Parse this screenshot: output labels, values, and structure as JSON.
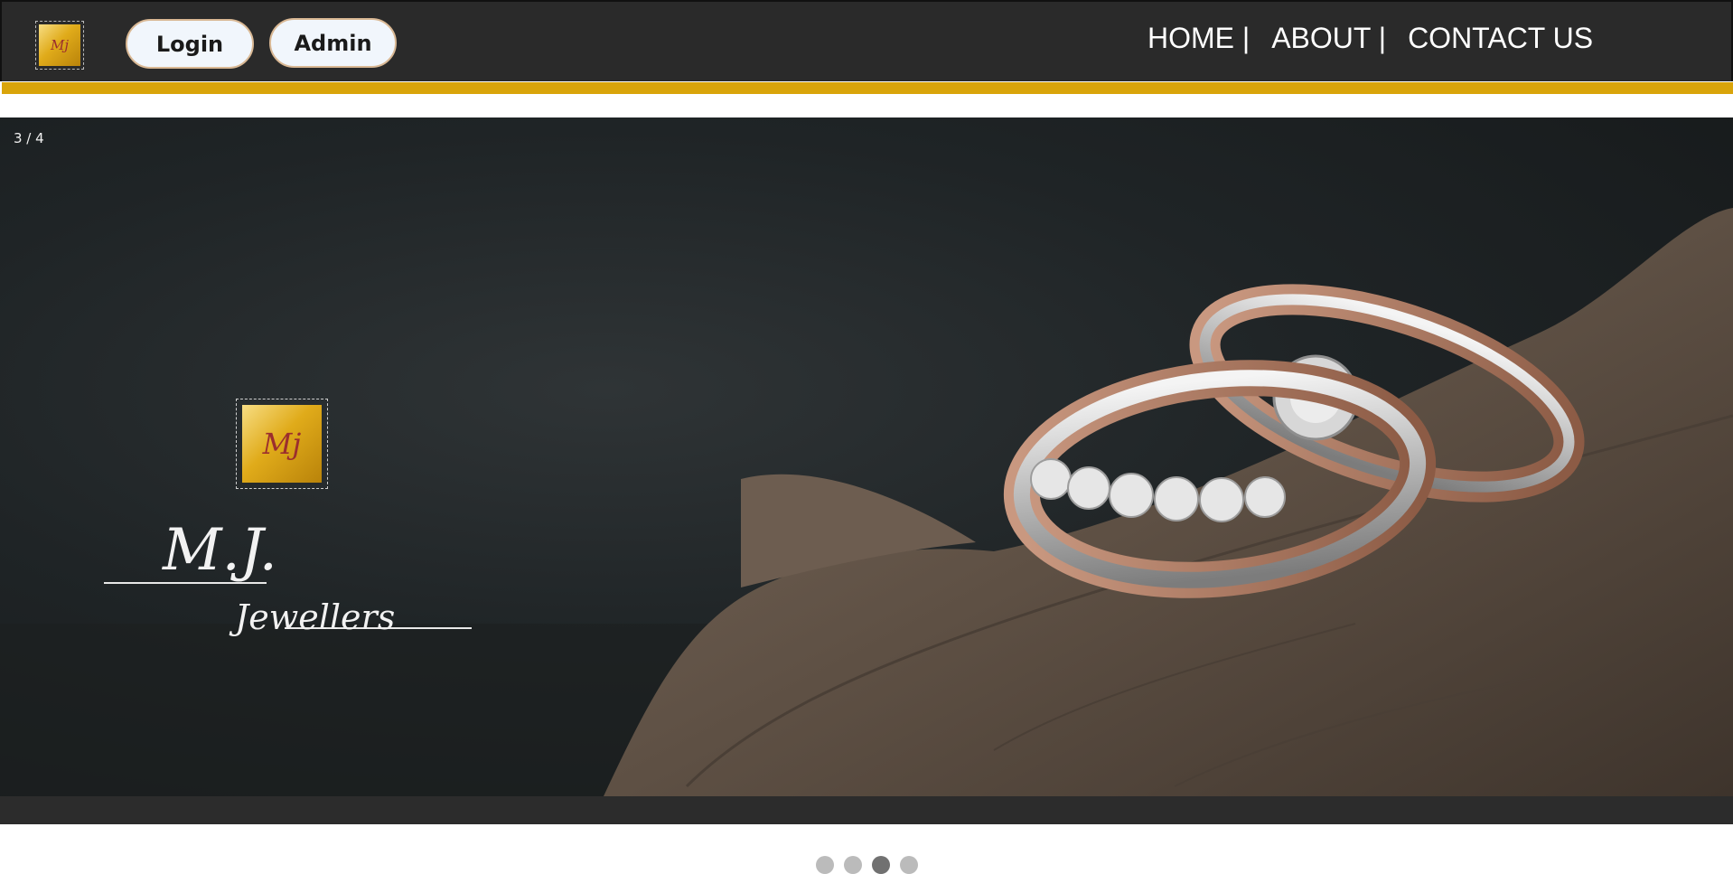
{
  "header": {
    "logo_icon": "mj-monogram-logo",
    "logo_text": "Mj",
    "buttons": {
      "login": "Login",
      "admin": "Admin"
    },
    "nav": [
      {
        "label": "HOME |"
      },
      {
        "label": "ABOUT |"
      },
      {
        "label": "CONTACT US"
      }
    ],
    "accent_color": "#d9a40a",
    "bar_color": "#2a2a2a"
  },
  "slideshow": {
    "counter": "3 / 4",
    "brand_monogram": "Mj",
    "brand_name_line1": "M.J.",
    "brand_name_line2": "Jewellers",
    "image_subject": "two-diamond-rings-on-dried-leaf",
    "dots": [
      {
        "active": false
      },
      {
        "active": false
      },
      {
        "active": true
      },
      {
        "active": false
      }
    ]
  }
}
